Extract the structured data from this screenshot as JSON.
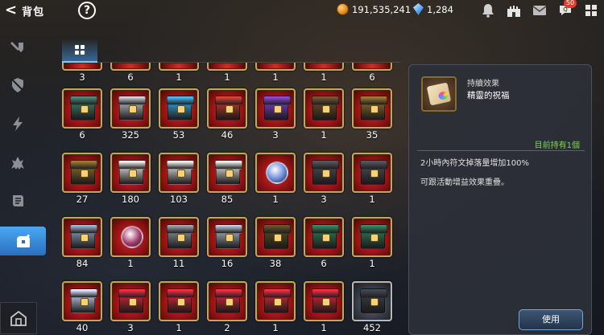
{
  "header": {
    "back_arrow": "<",
    "title": "背包",
    "help_glyph": "?",
    "gold": "191,535,241",
    "gems": "1,284",
    "chat_badge": "50"
  },
  "colors": {
    "accent_blue": "#3a8ee6",
    "slot_red": "#b01a18",
    "slot_gold_border": "#c9a35a",
    "owned_green": "#7dd35a"
  },
  "sidebar": {
    "items": [
      {
        "icon": "sword-shield-icon"
      },
      {
        "icon": "shield-slash-icon"
      },
      {
        "icon": "lightning-icon"
      },
      {
        "icon": "dragon-icon"
      },
      {
        "icon": "scroll-icon"
      },
      {
        "icon": "treasure-chest-icon",
        "active": true
      }
    ],
    "bottom_icon": "house-icon"
  },
  "inventory": {
    "top_partial_counts": [
      "3",
      "6",
      "1",
      "1",
      "1",
      "1",
      "6"
    ],
    "rows": [
      [
        {
          "count": "6",
          "icon": "teal-chest-icon"
        },
        {
          "count": "325",
          "icon": "silver-chest-icon"
        },
        {
          "count": "53",
          "icon": "blue-chest-icon"
        },
        {
          "count": "46",
          "icon": "red-chest-icon"
        },
        {
          "count": "3",
          "icon": "purple-chest-icon"
        },
        {
          "count": "1",
          "icon": "wooden-chest-icon"
        },
        {
          "count": "35",
          "icon": "gold-chest-icon"
        }
      ],
      [
        {
          "count": "27",
          "icon": "gold-chest-icon"
        },
        {
          "count": "180",
          "icon": "white-chest-icon"
        },
        {
          "count": "103",
          "icon": "white-chest-icon"
        },
        {
          "count": "85",
          "icon": "white-chest-icon"
        },
        {
          "count": "1",
          "icon": "crystal-orb-icon"
        },
        {
          "count": "3",
          "icon": "dark-chest-icon"
        },
        {
          "count": "1",
          "icon": "dark-chest-icon"
        }
      ],
      [
        {
          "count": "84",
          "icon": "ornate-chest-icon"
        },
        {
          "count": "1",
          "icon": "lantern-icon"
        },
        {
          "count": "11",
          "icon": "gray-chest-icon"
        },
        {
          "count": "16",
          "icon": "steel-chest-icon"
        },
        {
          "count": "38",
          "icon": "dark-gold-chest-icon"
        },
        {
          "count": "6",
          "icon": "green-chest-icon"
        },
        {
          "count": "1",
          "icon": "green-chest-icon"
        }
      ],
      [
        {
          "count": "40",
          "icon": "pearl-chest-icon"
        },
        {
          "count": "3",
          "icon": "red-box-icon"
        },
        {
          "count": "1",
          "icon": "red-box-icon"
        },
        {
          "count": "2",
          "icon": "red-box-icon"
        },
        {
          "count": "1",
          "icon": "red-box-icon"
        },
        {
          "count": "1",
          "icon": "red-box-icon"
        },
        {
          "count": "452",
          "icon": "dark-cube-icon"
        }
      ]
    ]
  },
  "detail": {
    "type": "持續效果",
    "name": "精靈的祝福",
    "owned": "目前持有1個",
    "desc1": "2小時內符文掉落量增加100%",
    "desc2": "可跟活動增益效果重疊。",
    "use_label": "使用"
  }
}
